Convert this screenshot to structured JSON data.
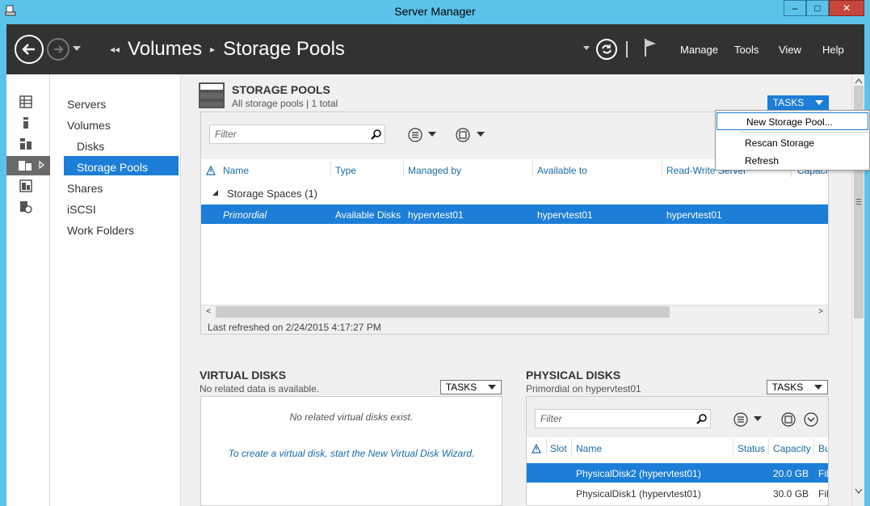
{
  "window": {
    "title": "Server Manager",
    "minimize": "–",
    "maximize": "□",
    "close": "✕"
  },
  "header": {
    "breadcrumb": [
      "Volumes",
      "Storage Pools"
    ],
    "menu": [
      "Manage",
      "Tools",
      "View",
      "Help"
    ]
  },
  "nav": {
    "items": [
      {
        "label": "Servers",
        "sub": false
      },
      {
        "label": "Volumes",
        "sub": false
      },
      {
        "label": "Disks",
        "sub": true
      },
      {
        "label": "Storage Pools",
        "sub": true,
        "selected": true
      },
      {
        "label": "Shares",
        "sub": false
      },
      {
        "label": "iSCSI",
        "sub": false
      },
      {
        "label": "Work Folders",
        "sub": false
      }
    ]
  },
  "storage_pools": {
    "title": "STORAGE POOLS",
    "subtitle": "All storage pools | 1 total",
    "tasks_label": "TASKS",
    "filter_placeholder": "Filter",
    "columns": [
      "Name",
      "Type",
      "Managed by",
      "Available to",
      "Read-Write Server",
      "Capacity"
    ],
    "group_label": "Storage Spaces (1)",
    "row": {
      "name": "Primordial",
      "type": "Available Disks",
      "managed_by": "hypervtest01",
      "available_to": "hypervtest01",
      "rw_server": "hypervtest01"
    },
    "last_refreshed": "Last refreshed on 2/24/2015 4:17:27 PM"
  },
  "tasks_menu": {
    "items": [
      "New Storage Pool...",
      "Rescan Storage",
      "Refresh"
    ]
  },
  "virtual_disks": {
    "title": "VIRTUAL DISKS",
    "subtitle": "No related data is available.",
    "tasks_label": "TASKS",
    "empty_message": "No related virtual disks exist.",
    "wizard_link": "To create a virtual disk, start the New Virtual Disk Wizard."
  },
  "physical_disks": {
    "title": "PHYSICAL DISKS",
    "subtitle": "Primordial on hypervtest01",
    "tasks_label": "TASKS",
    "filter_placeholder": "Filter",
    "columns": [
      "Slot",
      "Name",
      "Status",
      "Capacity",
      "Bu"
    ],
    "rows": [
      {
        "name": "PhysicalDisk2 (hypervtest01)",
        "capacity": "20.0 GB",
        "bus": "Fil",
        "selected": true
      },
      {
        "name": "PhysicalDisk1 (hypervtest01)",
        "capacity": "30.0 GB",
        "bus": "Fil",
        "selected": false
      }
    ]
  }
}
